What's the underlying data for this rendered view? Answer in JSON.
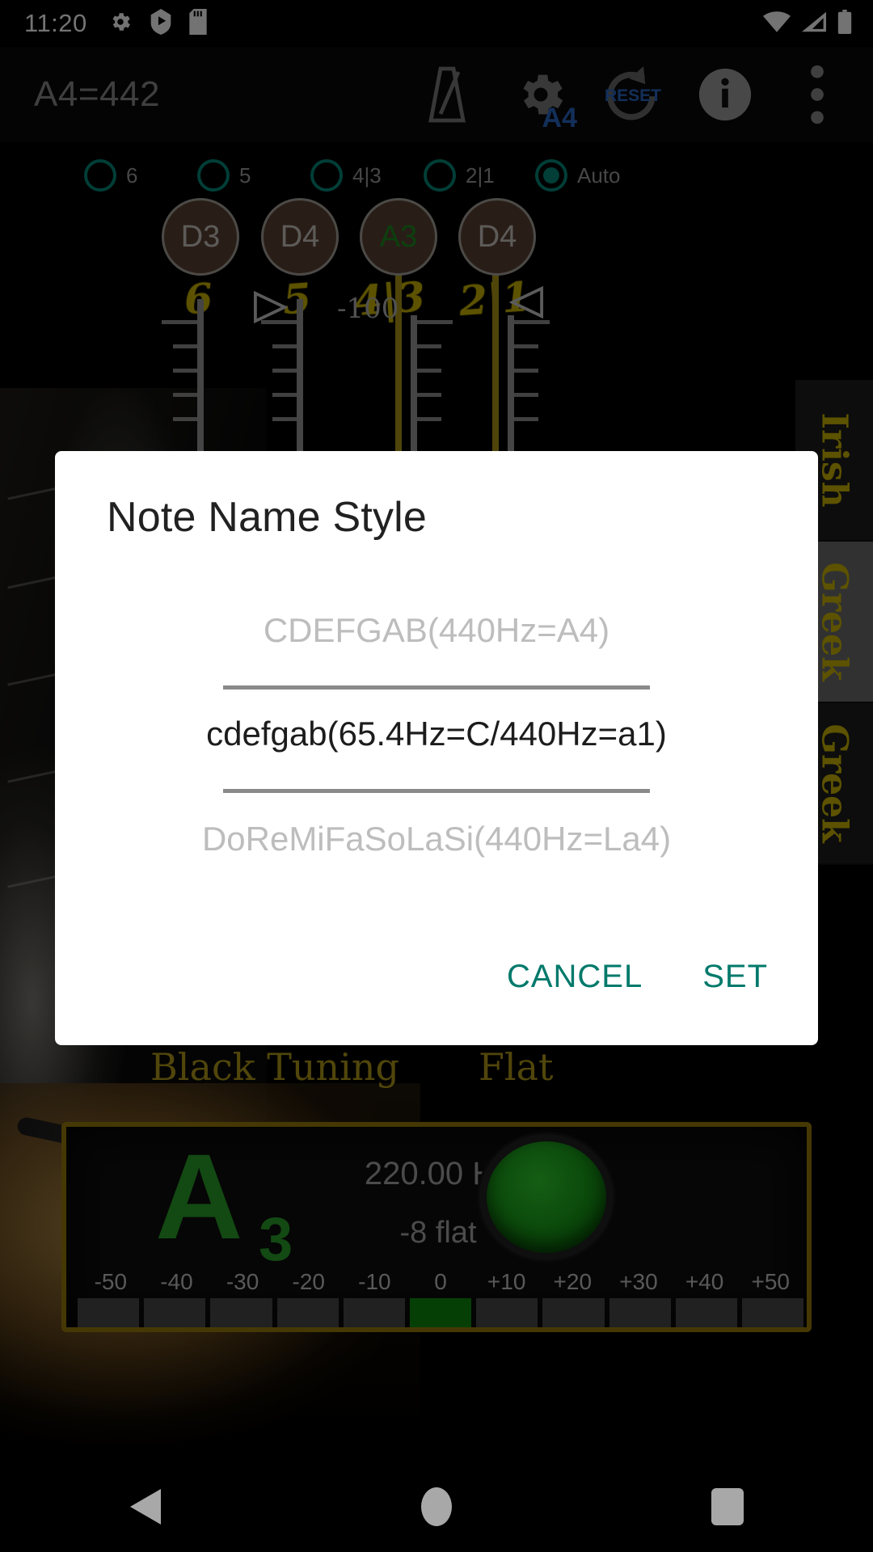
{
  "status_bar": {
    "time": "11:20",
    "left_icons": [
      "gear-icon",
      "play-shield-icon",
      "sd-card-icon"
    ],
    "right_icons": [
      "wifi-icon",
      "cell-signal-icon",
      "battery-icon"
    ]
  },
  "app_bar": {
    "title": "A4=442",
    "actions": [
      {
        "name": "metronome-icon",
        "label": ""
      },
      {
        "name": "gear-a4-icon",
        "label": "A4"
      },
      {
        "name": "reset-icon",
        "label": "RESET"
      },
      {
        "name": "info-icon",
        "label": "i"
      },
      {
        "name": "overflow-menu-icon",
        "label": ""
      }
    ]
  },
  "string_selector": {
    "options": [
      {
        "label": "6",
        "selected": false
      },
      {
        "label": "5",
        "selected": false
      },
      {
        "label": "4|3",
        "selected": false
      },
      {
        "label": "2|1",
        "selected": false
      },
      {
        "label": "Auto",
        "selected": true
      }
    ],
    "accent_color": "#00897b"
  },
  "pegs": [
    {
      "label": "D3",
      "active": false
    },
    {
      "label": "D4",
      "active": false
    },
    {
      "label": "A3",
      "active": true
    },
    {
      "label": "D4",
      "active": false
    }
  ],
  "strings": {
    "numbers": [
      "6",
      "5",
      "4|3",
      "2|1"
    ],
    "cent_marker": "-100"
  },
  "side_tabs": [
    {
      "label": "Irish",
      "highlighted": false
    },
    {
      "label": "Greek",
      "highlighted": true
    },
    {
      "label": "Greek",
      "highlighted": false
    }
  ],
  "background_captions": {
    "tuning": "Black Tuning",
    "flat": "Flat"
  },
  "tuner": {
    "note": "A",
    "octave": "3",
    "frequency": "220.00 Hz",
    "deviation": "-8 flat",
    "led_color": "#2aa32a",
    "scale_labels": [
      "-50",
      "-40",
      "-30",
      "-20",
      "-10",
      "0",
      "+10",
      "+20",
      "+30",
      "+40",
      "+50"
    ],
    "lit_index": 5
  },
  "dialog": {
    "title": "Note Name Style",
    "options": [
      {
        "label": "CDEFGAB(440Hz=A4)",
        "selected": false
      },
      {
        "label": "cdefgab(65.4Hz=C/440Hz=a1)",
        "selected": true
      },
      {
        "label": "DoReMiFaSoLaSi(440Hz=La4)",
        "selected": false
      }
    ],
    "cancel_label": "CANCEL",
    "set_label": "SET",
    "button_color": "#00796b"
  },
  "nav_bar": {
    "back": "back-icon",
    "home": "home-icon",
    "recents": "recents-icon"
  }
}
